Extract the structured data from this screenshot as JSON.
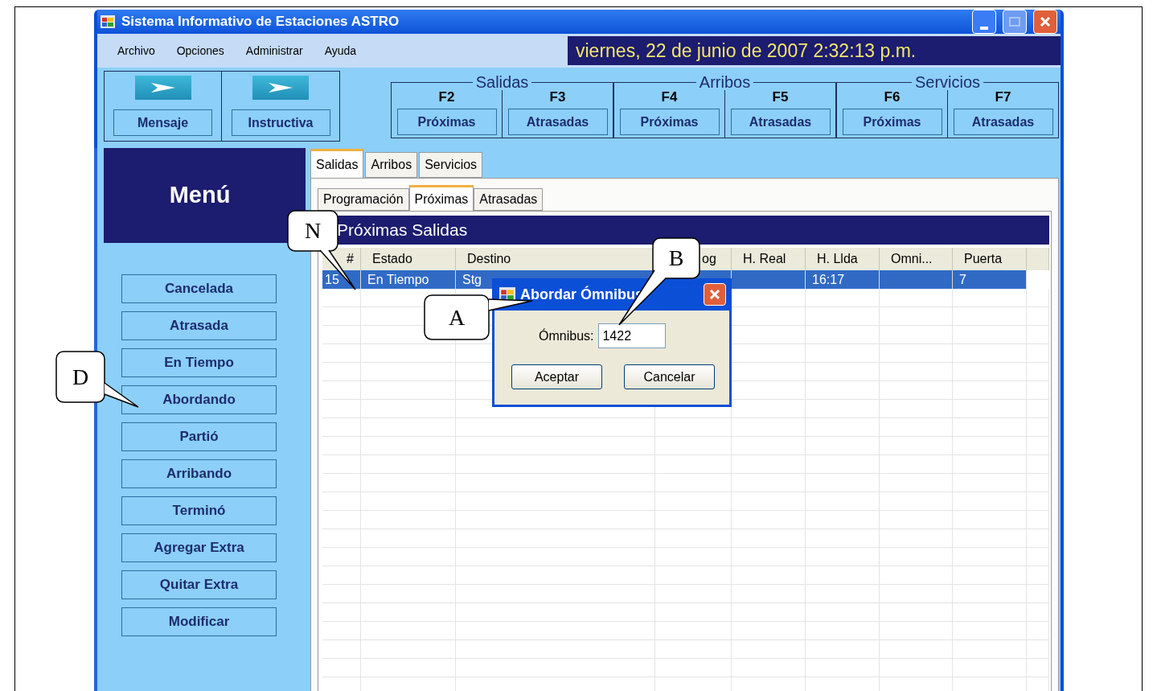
{
  "window": {
    "title": "Sistema Informativo de Estaciones ASTRO",
    "maximize_disabled": true
  },
  "menu": [
    {
      "label": "Archivo"
    },
    {
      "label": "Opciones"
    },
    {
      "label": "Administrar"
    },
    {
      "label": "Ayuda"
    }
  ],
  "clock": "viernes, 22 de junio de 2007 2:32:13 p.m.",
  "quick_buttons": [
    {
      "label": "Mensaje"
    },
    {
      "label": "Instructiva"
    }
  ],
  "groups": [
    {
      "title": "Salidas",
      "keys": [
        {
          "key": "F2",
          "label": "Próximas"
        },
        {
          "key": "F3",
          "label": "Atrasadas"
        }
      ]
    },
    {
      "title": "Arribos",
      "keys": [
        {
          "key": "F4",
          "label": "Próximas"
        },
        {
          "key": "F5",
          "label": "Atrasadas"
        }
      ]
    },
    {
      "title": "Servicios",
      "keys": [
        {
          "key": "F6",
          "label": "Próximas"
        },
        {
          "key": "F7",
          "label": "Atrasadas"
        }
      ]
    }
  ],
  "sidebar": {
    "title": "Menú",
    "buttons": [
      "Cancelada",
      "Atrasada",
      "En Tiempo",
      "Abordando",
      "Partió",
      "Arribando",
      "Terminó",
      "Agregar Extra",
      "Quitar Extra",
      "Modificar"
    ]
  },
  "tabs": [
    {
      "label": "Salidas",
      "selected": true
    },
    {
      "label": "Arribos",
      "selected": false
    },
    {
      "label": "Servicios",
      "selected": false
    }
  ],
  "subtabs": [
    {
      "label": "Programación",
      "selected": false
    },
    {
      "label": "Próximas",
      "selected": true
    },
    {
      "label": "Atrasadas",
      "selected": false
    }
  ],
  "table": {
    "title": "Próximas Salidas",
    "columns": [
      "#",
      "Estado",
      "Destino",
      "og",
      "H. Real",
      "H. Llda",
      "Omni...",
      "Puerta"
    ],
    "rows": [
      {
        "selected": true,
        "number": "15",
        "estado": "En Tiempo",
        "destino": "Stg",
        "h_llda": "16:17",
        "puerta": "7"
      }
    ]
  },
  "dialog": {
    "title": "Abordar Ómnibus",
    "field_label": "Ómnibus:",
    "value": "1422",
    "buttons": [
      "Aceptar",
      "Cancelar"
    ]
  },
  "callouts": [
    {
      "label": "N"
    },
    {
      "label": "B"
    },
    {
      "label": "A"
    },
    {
      "label": "D"
    }
  ]
}
